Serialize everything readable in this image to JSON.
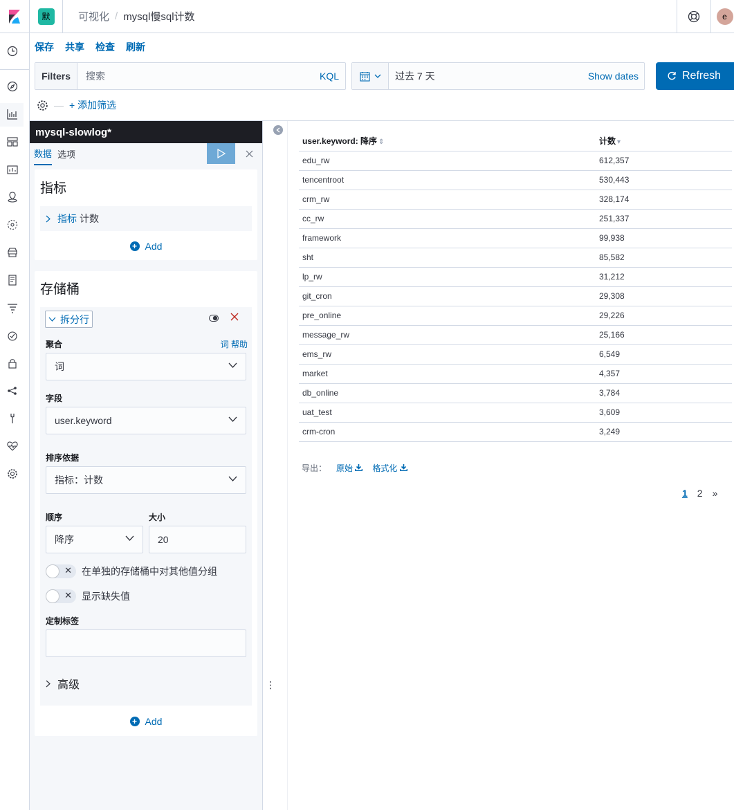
{
  "header": {
    "space_badge": "默",
    "breadcrumb_parent": "可视化",
    "breadcrumb_current": "mysql慢sql计数",
    "avatar_initial": "e"
  },
  "topmenu": [
    "保存",
    "共享",
    "检查",
    "刷新"
  ],
  "query": {
    "filters_label": "Filters",
    "search_placeholder": "搜索",
    "kql_label": "KQL"
  },
  "date": {
    "range": "过去 7 天",
    "show_dates": "Show dates"
  },
  "refresh_label": "Refresh",
  "add_filter": "+ 添加筛选",
  "sidebar": {
    "index_pattern": "mysql-slowlog*",
    "tabs": [
      "数据",
      "选项"
    ],
    "metrics_title": "指标",
    "metric_label": "指标",
    "metric_value": "计数",
    "add_label": "Add",
    "buckets_title": "存储桶",
    "bucket_name": "拆分行",
    "aggregation_label": "聚合",
    "aggregation_help": "词 帮助",
    "aggregation_value": "词",
    "field_label": "字段",
    "field_value": "user.keyword",
    "order_by_label": "排序依据",
    "order_by_value": "指标：计数",
    "order_label": "顺序",
    "order_value": "降序",
    "size_label": "大小",
    "size_value": "20",
    "other_bucket_label": "在单独的存储桶中对其他值分组",
    "missing_label": "显示缺失值",
    "custom_label": "定制标签",
    "custom_value": "",
    "advanced_label": "高级"
  },
  "table": {
    "headers": [
      "user.keyword: 降序",
      "计数"
    ],
    "rows": [
      [
        "edu_rw",
        "612,357"
      ],
      [
        "tencentroot",
        "530,443"
      ],
      [
        "crm_rw",
        "328,174"
      ],
      [
        "cc_rw",
        "251,337"
      ],
      [
        "framework",
        "99,938"
      ],
      [
        "sht",
        "85,582"
      ],
      [
        "lp_rw",
        "31,212"
      ],
      [
        "git_cron",
        "29,308"
      ],
      [
        "pre_online",
        "29,226"
      ],
      [
        "message_rw",
        "25,166"
      ],
      [
        "ems_rw",
        "6,549"
      ],
      [
        "market",
        "4,357"
      ],
      [
        "db_online",
        "3,784"
      ],
      [
        "uat_test",
        "3,609"
      ],
      [
        "crm-cron",
        "3,249"
      ]
    ]
  },
  "export": {
    "label": "导出：",
    "raw": "原始",
    "formatted": "格式化"
  },
  "pager": {
    "pages": [
      "1",
      "2"
    ],
    "next": "»"
  },
  "colors": {
    "accent": "#006bb4",
    "danger": "#bd271e",
    "index_bar": "#1d1e24",
    "space_badge": "#1fb8a3"
  }
}
